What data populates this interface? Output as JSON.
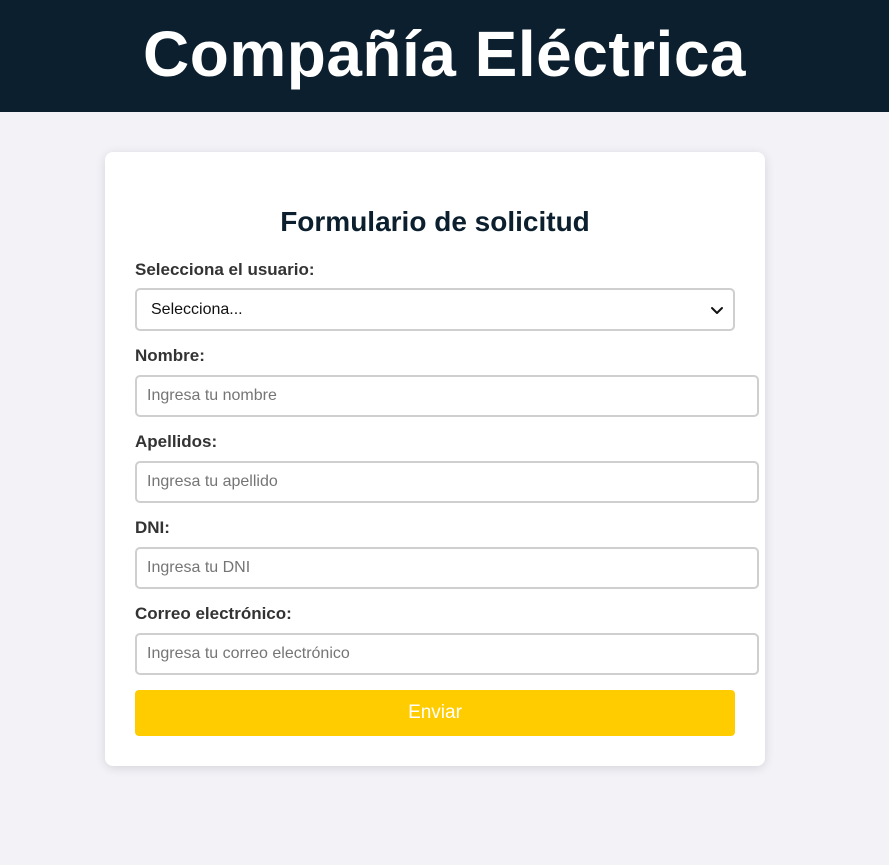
{
  "header": {
    "title": "Compañía Eléctrica"
  },
  "form": {
    "title": "Formulario de solicitud",
    "user_select": {
      "label": "Selecciona el usuario:",
      "selected": "Selecciona...",
      "icon": "chevron-down-icon"
    },
    "nombre": {
      "label": "Nombre:",
      "placeholder": "Ingresa tu nombre"
    },
    "apellidos": {
      "label": "Apellidos:",
      "placeholder": "Ingresa tu apellido"
    },
    "dni": {
      "label": "DNI:",
      "placeholder": "Ingresa tu DNI"
    },
    "correo": {
      "label": "Correo electrónico:",
      "placeholder": "Ingresa tu correo electrónico"
    },
    "submit_label": "Enviar"
  },
  "colors": {
    "header_bg": "#0c1f2e",
    "page_bg": "#f2f2f7",
    "button_bg": "#ffcc00",
    "title_color": "#0c1f2e"
  }
}
